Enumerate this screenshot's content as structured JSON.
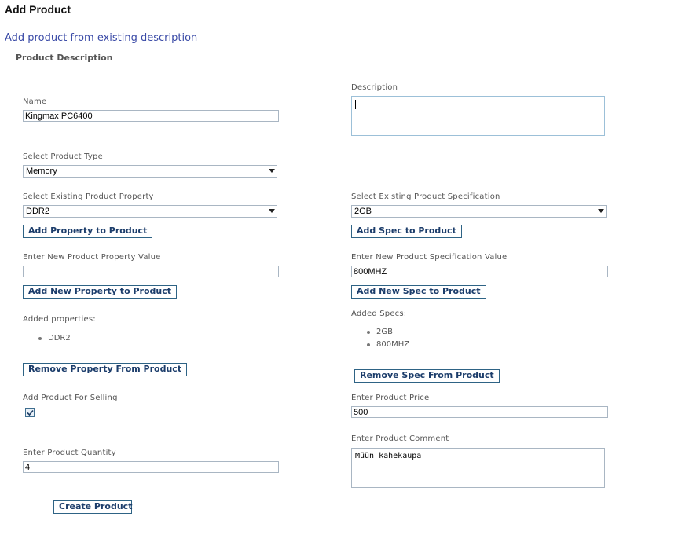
{
  "page": {
    "title": "Add Product",
    "existing_link": "Add product from existing description"
  },
  "form": {
    "legend": "Product Description",
    "name": {
      "label": "Name",
      "value": "Kingmax PC6400"
    },
    "description": {
      "label": "Description",
      "value": ""
    },
    "product_type": {
      "label": "Select Product Type",
      "selected": "Memory"
    },
    "existing_property": {
      "label": "Select Existing Product Property",
      "selected": "DDR2"
    },
    "existing_spec": {
      "label": "Select Existing Product Specification",
      "selected": "2GB"
    },
    "add_property_button": "Add Property to Product",
    "add_spec_button": "Add Spec to Product",
    "new_property": {
      "label": "Enter New Product Property Value",
      "value": ""
    },
    "new_spec": {
      "label": "Enter New Product Specification Value",
      "value": "800MHZ"
    },
    "add_new_property_button": "Add New Property to Product",
    "add_new_spec_button": "Add New Spec to Product",
    "added_properties": {
      "label": "Added properties:",
      "items": [
        "DDR2"
      ]
    },
    "added_specs": {
      "label": "Added Specs:",
      "items": [
        "2GB",
        "800MHZ"
      ]
    },
    "remove_property_button": "Remove Property From Product",
    "remove_spec_button": "Remove Spec From Product",
    "for_selling": {
      "label": "Add Product For Selling",
      "checked": true
    },
    "price": {
      "label": "Enter Product Price",
      "value": "500"
    },
    "comment": {
      "label": "Enter Product Comment",
      "value": "Müün kahekaupa"
    },
    "quantity": {
      "label": "Enter Product Quantity",
      "value": "4"
    },
    "create_button": "Create Product"
  },
  "colors": {
    "button_border": "#2e6385",
    "link": "#3b4ba7",
    "fieldset_border": "#c8c8c8"
  }
}
